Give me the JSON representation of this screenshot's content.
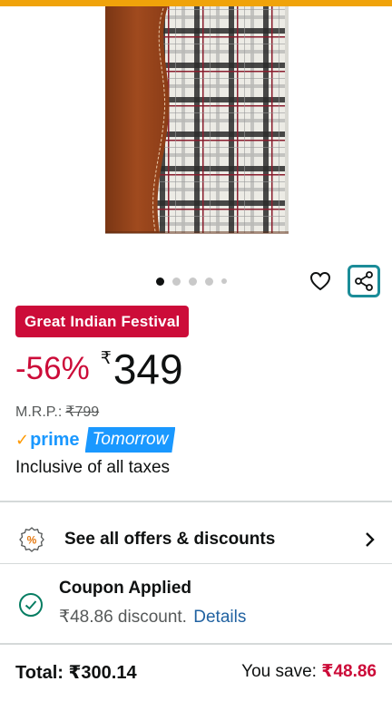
{
  "gallery": {
    "image_alt": "Brown leather and checked fabric file folder",
    "dot_count": 5,
    "active_dot": 0
  },
  "actions": {
    "wishlist_icon": "heart-outline-icon",
    "share_icon": "share-icon"
  },
  "deal": {
    "badge_label": "Great Indian Festival"
  },
  "pricing": {
    "discount": "-56%",
    "currency_symbol": "₹",
    "price": "349",
    "mrp_label": "M.R.P.:",
    "mrp_value": "₹799"
  },
  "delivery": {
    "prime_check": "✓",
    "prime_label": "prime",
    "day_label": "Tomorrow",
    "tax_note": "Inclusive of all taxes"
  },
  "offers": {
    "label": "See all offers & discounts",
    "icon": "percent-badge-icon"
  },
  "coupon": {
    "title": "Coupon Applied",
    "detail_text": "₹48.86 discount.",
    "details_link": "Details"
  },
  "summary": {
    "total_label": "Total: ₹300.14",
    "you_save_label": "You save:",
    "you_save_amount": "₹48.86"
  },
  "colors": {
    "deal_red": "#cc0c39",
    "prime_blue": "#1a98ff",
    "link_blue": "#2162a1",
    "share_teal": "#1b8c98",
    "top_orange": "#f0a30a"
  }
}
